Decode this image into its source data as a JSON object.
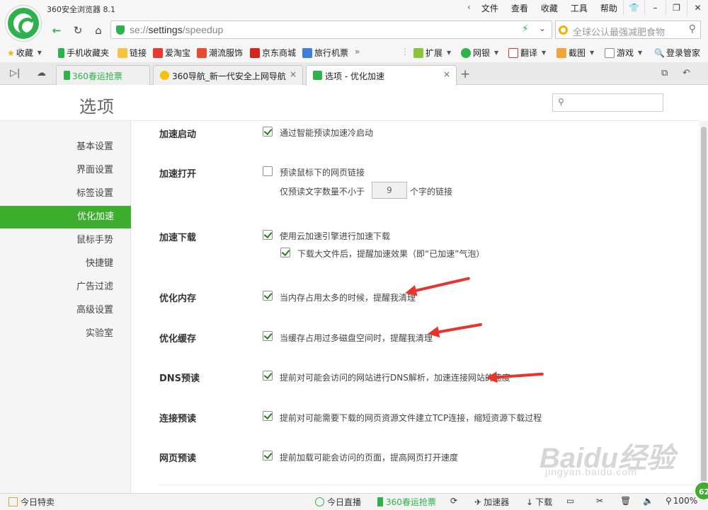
{
  "window": {
    "title": "360安全浏览器 8.1",
    "menus": [
      "文件",
      "查看",
      "收藏",
      "工具",
      "帮助"
    ],
    "controls": [
      "shirt-icon",
      "minimize-icon",
      "restore-icon",
      "close-icon"
    ]
  },
  "address_bar": {
    "url_scheme": "se://",
    "url_host": "settings",
    "url_path": "/speedup",
    "search_placeholder": "全球公认最强减肥食物"
  },
  "bookmarks": {
    "favorites": "收藏",
    "items": [
      "手机收藏夹",
      "链接",
      "爱淘宝",
      "潮流服饰",
      "京东商城",
      "旅行机票"
    ],
    "more": "»",
    "tools": [
      "扩展",
      "网银",
      "翻译",
      "截图",
      "游戏",
      "登录管家"
    ]
  },
  "tabs": [
    {
      "label": "360春运抢票"
    },
    {
      "label": "360导航_新一代安全上网导航"
    },
    {
      "label": "选项 - 优化加速"
    }
  ],
  "page": {
    "title": "选项",
    "sidebar": [
      "基本设置",
      "界面设置",
      "标签设置",
      "优化加速",
      "鼠标手势",
      "快捷键",
      "广告过滤",
      "高级设置",
      "实验室"
    ],
    "active_sidebar": "优化加速",
    "sections": {
      "boot": {
        "label": "加速启动",
        "opt": "通过智能预读加速冷启动"
      },
      "open": {
        "label": "加速打开",
        "opt": "预读鼠标下的网页链接",
        "sub_prefix": "仅预读文字数量不小于",
        "sub_value": "9",
        "sub_suffix": "个字的链接"
      },
      "download": {
        "label": "加速下载",
        "opt": "使用云加速引擎进行加速下载",
        "sub": "下载大文件后，提醒加速效果（即“已加速”气泡）"
      },
      "memory": {
        "label": "优化内存",
        "opt": "当内存占用太多的时候，提醒我清理"
      },
      "cache": {
        "label": "优化缓存",
        "opt": "当缓存占用过多磁盘空间时，提醒我清理"
      },
      "dns": {
        "label": "DNS预读",
        "opt": "提前对可能会访问的网站进行DNS解析，加速连接网站的速度"
      },
      "connect": {
        "label": "连接预读",
        "opt": "提前对可能需要下载的网页资源文件建立TCP连接，缩短资源下载过程"
      },
      "page": {
        "label": "网页预读",
        "opt": "提前加载可能会访问的页面，提高网页打开速度"
      }
    }
  },
  "watermark": {
    "brand": "Baidu经验",
    "url": "jingyan.baidu.com"
  },
  "status_bar": {
    "left": "今日特卖",
    "items": [
      "今日直播",
      "360春运抢票",
      "加速器",
      "下载",
      "100%"
    ],
    "badge": "62"
  },
  "colors": {
    "accent": "#3cad2d",
    "arrow": "#e8342a"
  }
}
